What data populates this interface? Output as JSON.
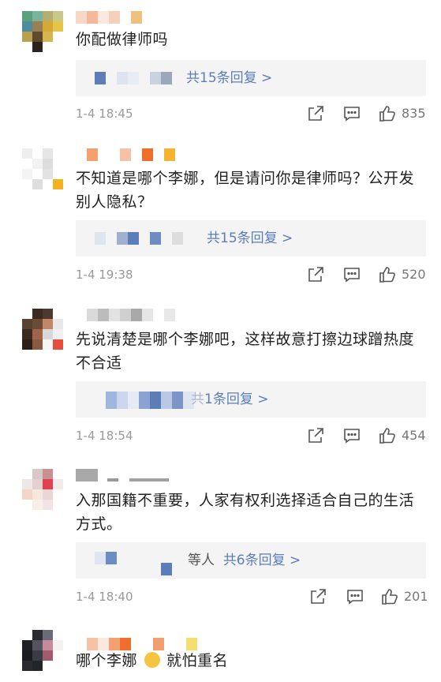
{
  "comments": [
    {
      "text": "你配做律师吗",
      "replies": "共15条回复 >",
      "time": "1-4 18:45",
      "likes": "835"
    },
    {
      "text": "不知道是哪个李娜，但是请问你是律师吗？公开发别人隐私？",
      "replies": "共15条回复 >",
      "time": "1-4 19:38",
      "likes": "520"
    },
    {
      "text": "先说清楚是哪个李娜吧，这样故意打擦边球蹭热度不合适",
      "replies": "1条回复 >",
      "reply_prefix": "共",
      "time": "1-4 18:54",
      "likes": "454"
    },
    {
      "text": "入那国籍不重要，人家有权利选择适合自己的生活方式。",
      "replies": "共6条回复 >",
      "others": "等人",
      "time": "1-4 18:40",
      "likes": "201"
    },
    {
      "text_before": "哪个李娜",
      "text_after": "就怕重名",
      "emoji": "face-emoji"
    }
  ],
  "icons": {
    "share": "share-icon",
    "comment": "comment-icon",
    "like": "thumbs-up-icon"
  },
  "colors": {
    "link": "#5b7db8",
    "reply_bg": "#f4f4f4",
    "meta": "#999999"
  }
}
